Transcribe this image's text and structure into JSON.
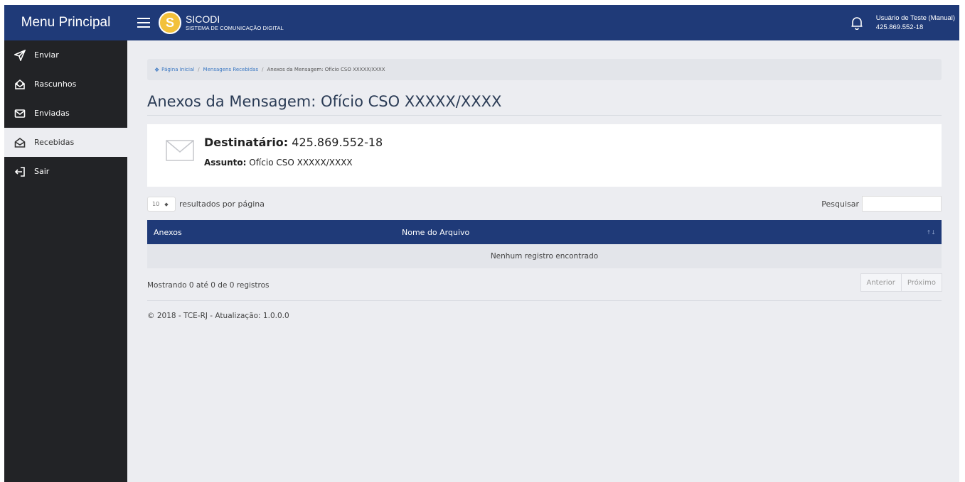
{
  "sidebar": {
    "title": "Menu Principal",
    "items": [
      {
        "label": "Enviar",
        "icon": "send-icon"
      },
      {
        "label": "Rascunhos",
        "icon": "drafts-icon"
      },
      {
        "label": "Enviadas",
        "icon": "envelope-icon"
      },
      {
        "label": "Recebidas",
        "icon": "open-envelope-icon"
      },
      {
        "label": "Sair",
        "icon": "logout-icon"
      }
    ]
  },
  "topbar": {
    "logo_letter": "S",
    "app_name": "SICODI",
    "app_subtitle": "SISTEMA DE COMUNICAÇÃO DIGITAL",
    "user_name": "Usuário de Teste (Manual)",
    "user_id": "425.869.552-18"
  },
  "breadcrumb": {
    "home": "Página Inicial",
    "sep": "/",
    "received": "Mensagens Recebidas",
    "current": "Anexos da Mensagem: Ofício CSO XXXXX/XXXX"
  },
  "page": {
    "title": "Anexos da Mensagem: Ofício CSO XXXXX/XXXX"
  },
  "message": {
    "dest_label": "Destinatário:",
    "dest_value": "425.869.552-18",
    "subject_label": "Assunto:",
    "subject_value": "Ofício CSO XXXXX/XXXX"
  },
  "table_controls": {
    "page_length": "10",
    "page_length_suffix": "resultados por página",
    "search_label": "Pesquisar",
    "search_value": ""
  },
  "table": {
    "columns": [
      "Anexos",
      "Nome do Arquivo"
    ],
    "empty_message": "Nenhum registro encontrado"
  },
  "pagination": {
    "info": "Mostrando 0 até 0 de 0 registros",
    "prev": "Anterior",
    "next": "Próximo"
  },
  "footer": {
    "text": "© 2018 - TCE-RJ - Atualização: 1.0.0.0"
  },
  "colors": {
    "primary": "#1f3a78",
    "sidebar_bg": "#222326",
    "content_bg": "#ecedf1",
    "logo": "#f2c13b",
    "link": "#3a77c2"
  }
}
